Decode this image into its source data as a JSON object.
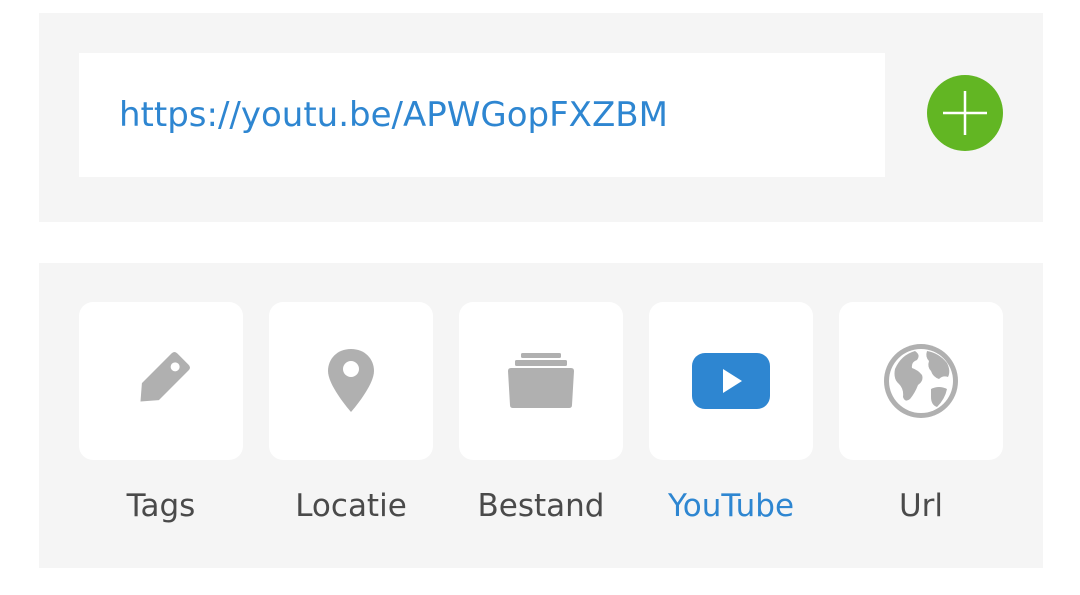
{
  "url_input": {
    "value": "https://youtu.be/APWGopFXZBM"
  },
  "add_button": {
    "icon": "plus-icon",
    "color": "#62b623"
  },
  "options": [
    {
      "label": "Tags",
      "icon": "tag-icon",
      "active": false
    },
    {
      "label": "Locatie",
      "icon": "location-pin-icon",
      "active": false
    },
    {
      "label": "Bestand",
      "icon": "folder-icon",
      "active": false
    },
    {
      "label": "YouTube",
      "icon": "youtube-play-icon",
      "active": true
    },
    {
      "label": "Url",
      "icon": "globe-icon",
      "active": false
    }
  ],
  "colors": {
    "accent": "#2e86d1",
    "icon_gray": "#b0b0b0",
    "panel_bg": "#f5f5f5",
    "label": "#4a4a4a"
  }
}
